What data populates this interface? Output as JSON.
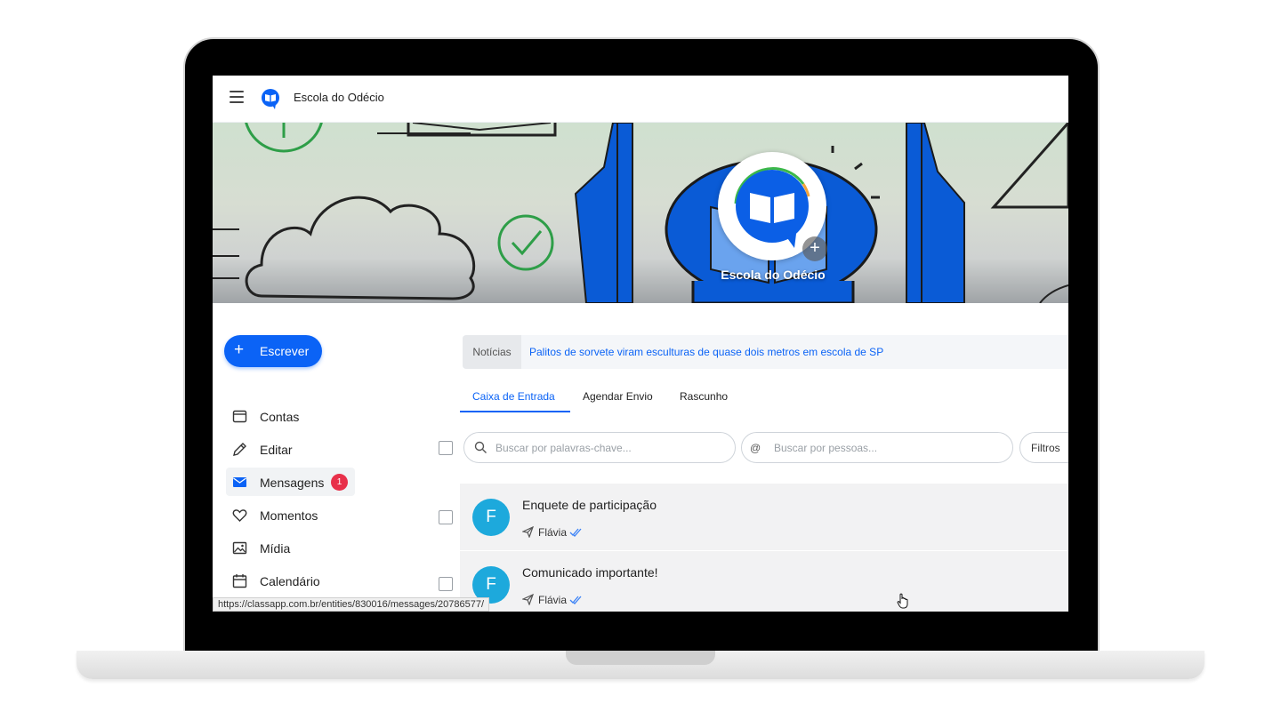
{
  "header": {
    "app_title": "Escola do Odécio"
  },
  "banner": {
    "entity_name": "Escola do Odécio",
    "add_symbol": "+"
  },
  "sidebar": {
    "compose_label": "Escrever",
    "items": [
      {
        "label": "Contas",
        "icon": "card-icon"
      },
      {
        "label": "Editar",
        "icon": "pencil-icon"
      },
      {
        "label": "Mensagens",
        "icon": "envelope-icon",
        "badge": "1",
        "active": true
      },
      {
        "label": "Momentos",
        "icon": "heart-icon"
      },
      {
        "label": "Mídia",
        "icon": "image-icon"
      },
      {
        "label": "Calendário",
        "icon": "calendar-icon"
      }
    ]
  },
  "news": {
    "label": "Notícias",
    "headline": "Palitos de sorvete viram esculturas de quase dois metros em escola de SP"
  },
  "tabs": [
    {
      "label": "Caixa de Entrada",
      "active": true
    },
    {
      "label": "Agendar Envio"
    },
    {
      "label": "Rascunho"
    }
  ],
  "search": {
    "keywords_placeholder": "Buscar por palavras-chave...",
    "people_symbol": "@",
    "people_placeholder": "Buscar por pessoas...",
    "filters_label": "Filtros"
  },
  "messages": [
    {
      "avatar_letter": "F",
      "subject": "Enquete de participação",
      "sender": "Flávia"
    },
    {
      "avatar_letter": "F",
      "subject": "Comunicado importante!",
      "sender": "Flávia"
    }
  ],
  "status_bar": {
    "url": "https://classapp.com.br/entities/830016/messages/20786577/"
  },
  "colors": {
    "accent": "#0b63f6",
    "badge": "#e8304a",
    "avatar": "#1da9dc"
  }
}
